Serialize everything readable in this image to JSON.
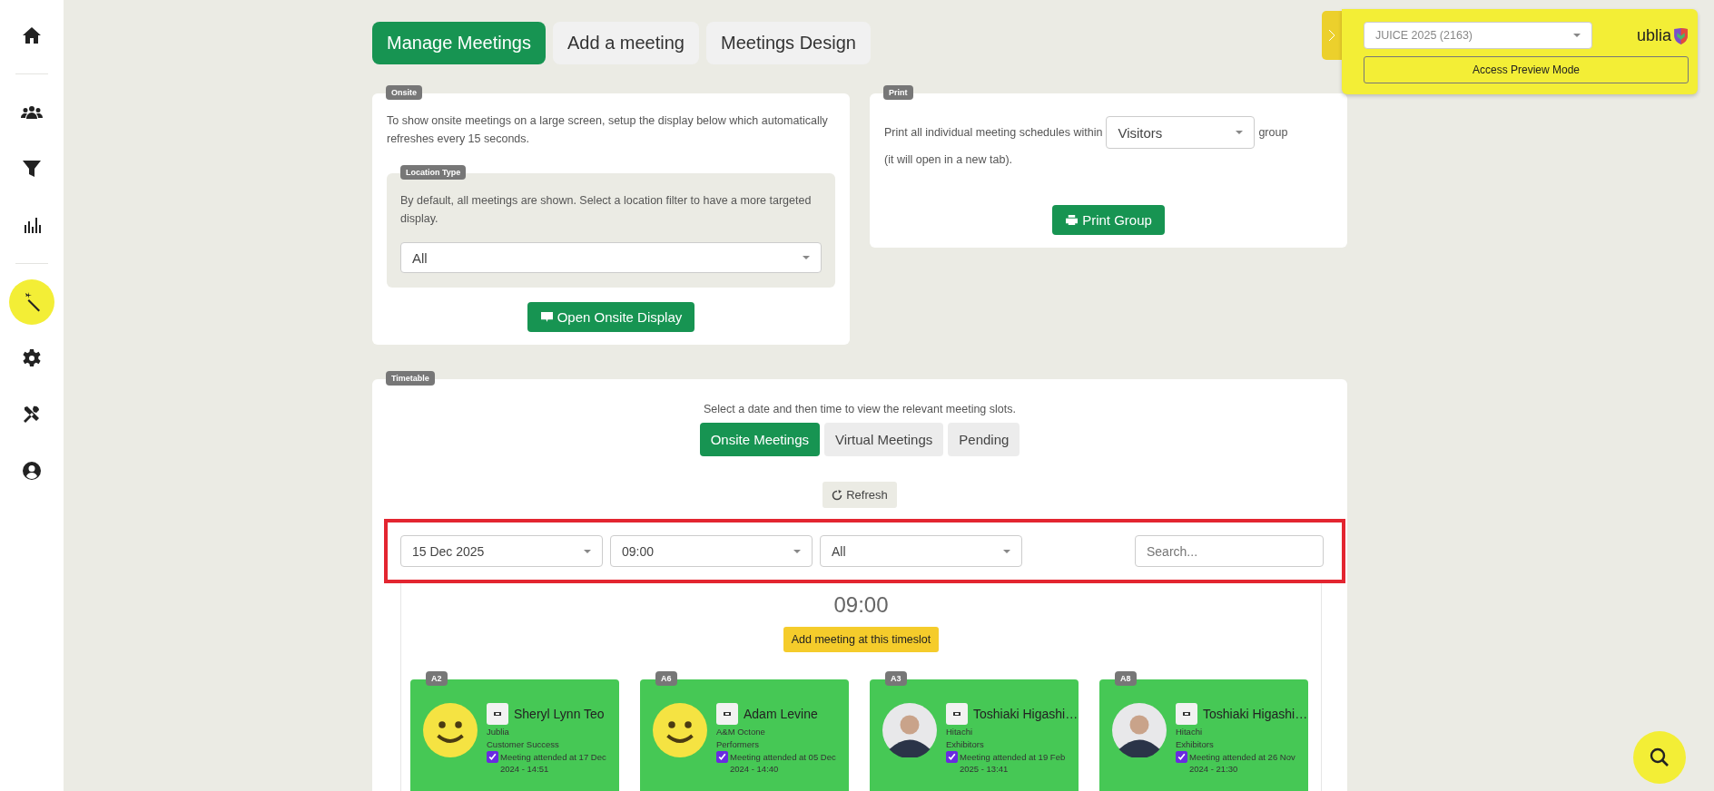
{
  "sidebar": {
    "groups": [
      [
        {
          "kind": "home",
          "selected": false
        }
      ],
      [
        {
          "kind": "people",
          "selected": false
        },
        {
          "kind": "funnel",
          "selected": false
        },
        {
          "kind": "chart",
          "selected": false
        }
      ],
      [
        {
          "kind": "wand",
          "selected": true
        },
        {
          "kind": "gear",
          "selected": false
        },
        {
          "kind": "tools",
          "selected": false
        },
        {
          "kind": "user",
          "selected": false
        }
      ]
    ]
  },
  "tabs": [
    {
      "label": "Manage Meetings",
      "selected": true
    },
    {
      "label": "Add a meeting",
      "selected": false
    },
    {
      "label": "Meetings Design",
      "selected": false
    }
  ],
  "onsite": {
    "badge": "Onsite",
    "text": "To show onsite meetings on a large screen, setup the display below which automatically refreshes every 15 seconds.",
    "location": {
      "badge": "Location Type",
      "text": "By default, all meetings are shown. Select a location filter to have a more targeted display.",
      "value": "All"
    },
    "button": "Open Onsite Display"
  },
  "print": {
    "badge": "Print",
    "text_before": "Print all individual meeting schedules within",
    "group_value": "Visitors",
    "text_after": "group",
    "note": "(it will open in a new tab).",
    "button": "Print Group"
  },
  "event_panel": {
    "event": "JUICE 2025 (2163)",
    "logo": "ublia",
    "button": "Access Preview Mode"
  },
  "timetable": {
    "badge": "Timetable",
    "hint": "Select a date and then time to view the relevant meeting slots.",
    "tabs": [
      {
        "label": "Onsite Meetings",
        "selected": true
      },
      {
        "label": "Virtual Meetings",
        "selected": false
      },
      {
        "label": "Pending",
        "selected": false
      }
    ],
    "refresh": "Refresh",
    "filters": {
      "date": "15 Dec 2025",
      "time": "09:00",
      "location": "All",
      "search_placeholder": "Search..."
    },
    "slot_time": "09:00",
    "add_button": "Add meeting at this timeslot",
    "meetings": [
      {
        "room": "A2",
        "kind": "smiley",
        "name": "Sheryl Lynn Teo",
        "company": "Jublia",
        "group": "Customer Success",
        "checked": true,
        "attended": "Meeting attended at 17 Dec 2024 - 14:51"
      },
      {
        "room": "A6",
        "kind": "smiley",
        "name": "Adam Levine",
        "company": "A&M Octone",
        "group": "Performers",
        "checked": true,
        "attended": "Meeting attended at 05 Dec 2024 - 14:40"
      },
      {
        "room": "A3",
        "kind": "photo",
        "name": "Toshiaki Higashi…",
        "company": "Hitachi",
        "group": "Exhibitors",
        "checked": true,
        "attended": "Meeting attended at 19 Feb 2025 - 13:41"
      },
      {
        "room": "A8",
        "kind": "photo",
        "name": "Toshiaki Higashi…",
        "company": "Hitachi",
        "group": "Exhibitors",
        "checked": true,
        "attended": "Meeting attended at 26 Nov 2024 - 21:30"
      }
    ]
  }
}
